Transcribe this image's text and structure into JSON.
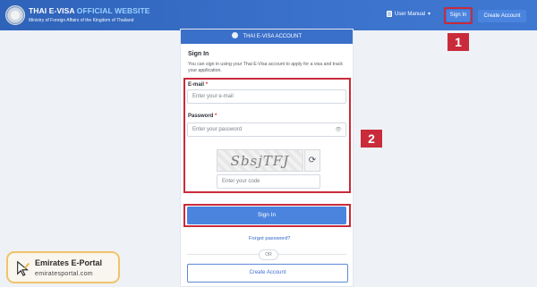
{
  "header": {
    "title_part1": "THAI E-VISA",
    "title_part2": "OFFICIAL WEBSITE",
    "subtitle": "Ministry of Foreign Affairs of the Kingdom of Thailand",
    "user_manual_label": "User Manual",
    "sign_in_label": "Sign In",
    "create_account_label": "Create Account",
    "colors": {
      "bar": "#3b72cc",
      "accent_button": "#4a84df"
    }
  },
  "card": {
    "header_title": "THAI E-VISA ACCOUNT",
    "section_title": "Sign In",
    "description": "You can sign in using your Thai E-Visa account to apply for a visa and track your application.",
    "email": {
      "label": "E-mail",
      "required_mark": "*",
      "placeholder": "Enter your e-mail",
      "value": ""
    },
    "password": {
      "label": "Password",
      "required_mark": "*",
      "placeholder": "Enter your password",
      "value": ""
    },
    "captcha": {
      "text": "SbsjTFJ",
      "code_placeholder": "Enter your code",
      "refresh_icon": "refresh-icon"
    },
    "sign_in_button": "Sign In",
    "forgot_password": "Forgot password?",
    "or_label": "OR",
    "create_account_button": "Create Account"
  },
  "annotations": {
    "badge1": "1",
    "badge2": "2",
    "color": "#c92b3a"
  },
  "watermark": {
    "title": "Emirates E-Portal",
    "subtitle": "emiratesportal.com"
  }
}
